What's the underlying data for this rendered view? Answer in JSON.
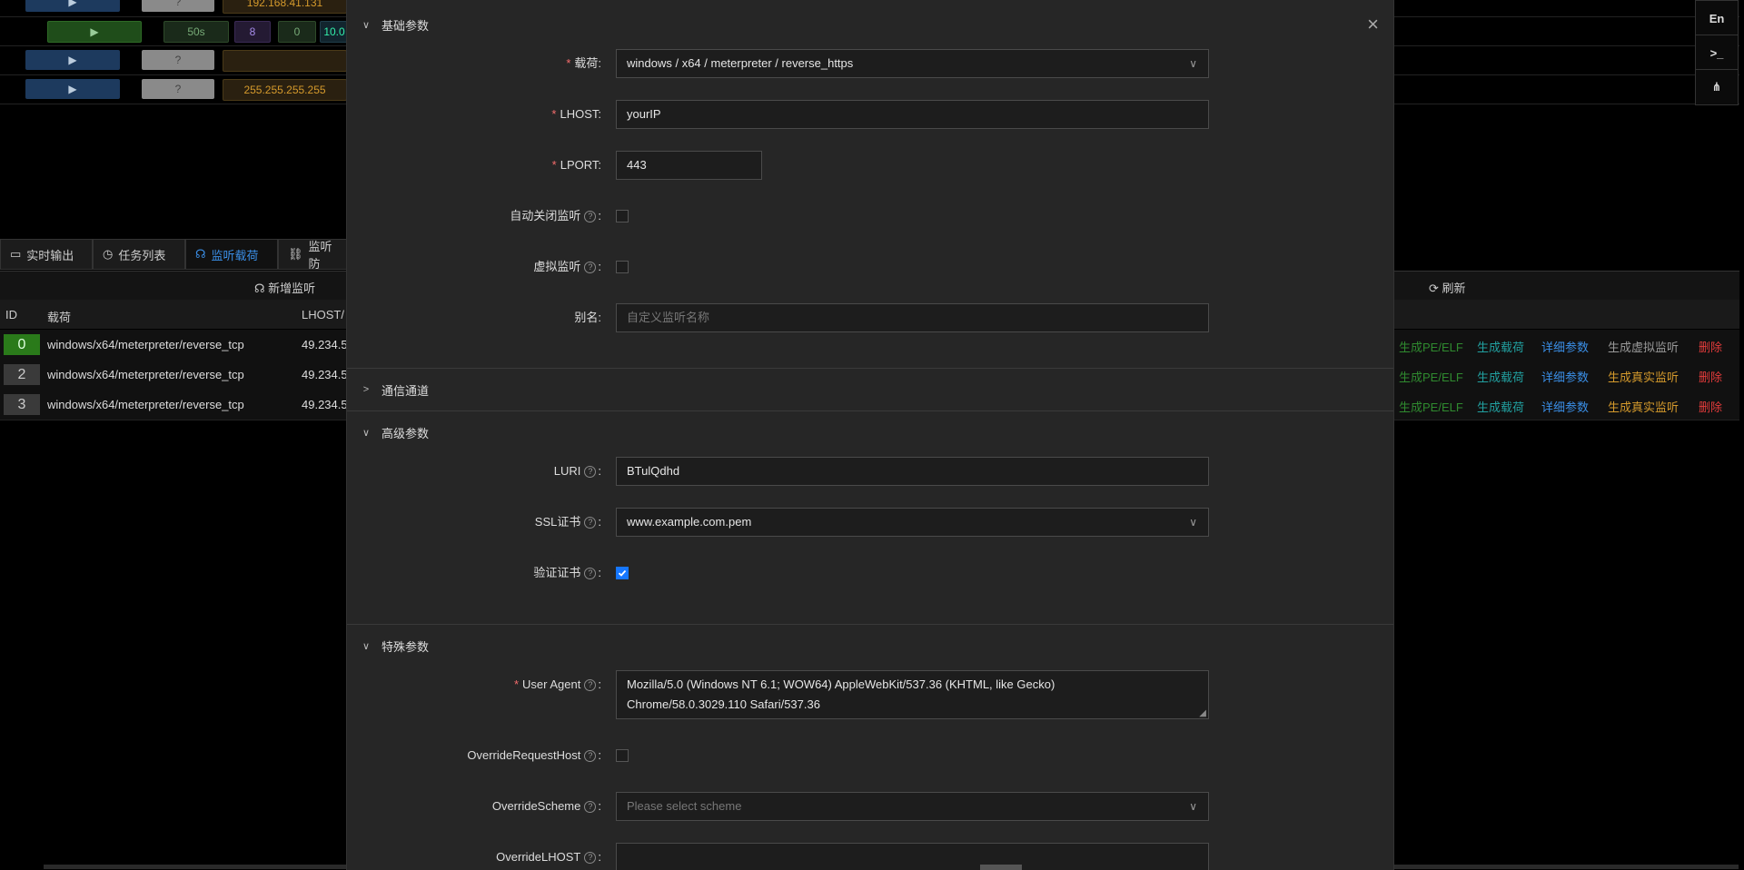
{
  "background": {
    "top_rows": [
      {
        "orange": "192.168.41.131"
      },
      {
        "green_a": "50s",
        "purple": "8",
        "green_b": "0",
        "teal": "10.0"
      },
      {
        "orange": ""
      },
      {
        "orange": "255.255.255.255"
      }
    ],
    "right_buttons": {
      "lang": "En"
    },
    "tabs": [
      "实时输出",
      "任务列表",
      "监听载荷",
      "监听防"
    ],
    "toolbar": {
      "new_listener": "新增监听",
      "refresh": "刷新"
    },
    "table_headers": {
      "id": "ID",
      "payload": "载荷",
      "lhost": "LHOST/"
    },
    "rows": [
      {
        "id": "0",
        "payload": "windows/x64/meterpreter/reverse_tcp",
        "lhost": "49.234.5",
        "a1": "生成PE/ELF",
        "a2": "生成载荷",
        "a3": "详细参数",
        "a4": "生成虚拟监听",
        "a5": "删除"
      },
      {
        "id": "2",
        "payload": "windows/x64/meterpreter/reverse_tcp",
        "lhost": "49.234.5",
        "a1": "生成PE/ELF",
        "a2": "生成载荷",
        "a3": "详细参数",
        "a4": "生成真实监听",
        "a5": "删除"
      },
      {
        "id": "3",
        "payload": "windows/x64/meterpreter/reverse_tcp",
        "lhost": "49.234.5",
        "a1": "生成PE/ELF",
        "a2": "生成载荷",
        "a3": "详细参数",
        "a4": "生成真实监听",
        "a5": "删除"
      }
    ]
  },
  "modal": {
    "close": "×",
    "basic": {
      "title": "基础参数",
      "payload_label": "载荷:",
      "payload_value": "windows / x64 / meterpreter / reverse_https",
      "lhost_label": "LHOST:",
      "lhost_value": "yourIP",
      "lport_label": "LPORT:",
      "lport_value": "443",
      "auto_close_label": "自动关闭监听",
      "virtual_label": "虚拟监听",
      "alias_label": "别名:",
      "alias_placeholder": "自定义监听名称"
    },
    "channel": {
      "title": "通信通道"
    },
    "advanced": {
      "title": "高级参数",
      "luri_label": "LURI",
      "luri_value": "BTulQdhd",
      "ssl_label": "SSL证书",
      "ssl_value": "www.example.com.pem",
      "verify_label": "验证证书"
    },
    "special": {
      "title": "特殊参数",
      "ua_label": "User Agent",
      "ua_line1": "Mozilla/5.0 (Windows NT 6.1; WOW64) AppleWebKit/537.36 (KHTML, like Gecko)",
      "ua_line2": "Chrome/58.0.3029.110 Safari/537.36",
      "orh_label": "OverrideRequestHost",
      "scheme_label": "OverrideScheme",
      "scheme_placeholder": "Please select scheme",
      "olhost_label": "OverrideLHOST"
    }
  },
  "colors": {
    "accent": "#1677ff",
    "danger": "#f56c6c",
    "green": "#3aa33a",
    "orange": "#d59a2c"
  }
}
